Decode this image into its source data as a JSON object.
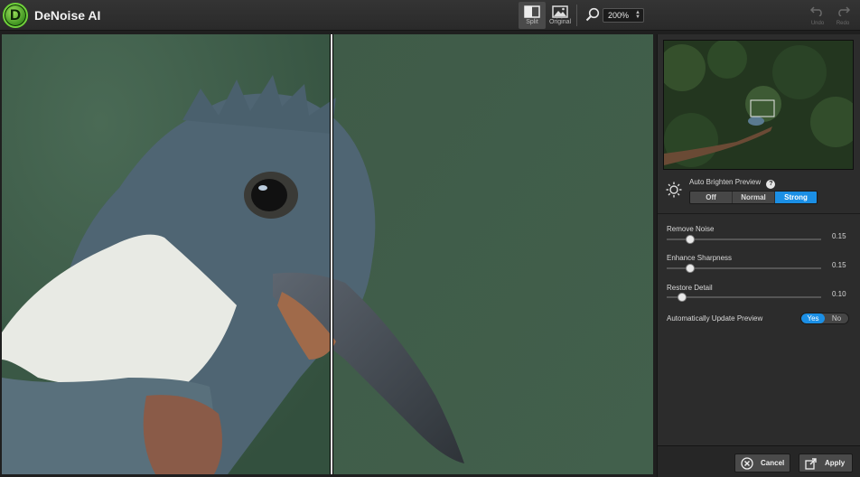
{
  "app": {
    "logo_letter": "D",
    "title": "DeNoise AI"
  },
  "toolbar": {
    "split_label": "Split",
    "original_label": "Original",
    "zoom_value": "200%",
    "undo_label": "Undo",
    "redo_label": "Redo"
  },
  "panel": {
    "auto_brighten": {
      "label": "Auto Brighten Preview",
      "help": "?",
      "options": [
        "Off",
        "Normal",
        "Strong"
      ],
      "selected": "Strong"
    },
    "sliders": [
      {
        "label": "Remove Noise",
        "value": "0.15",
        "fraction": 0.15
      },
      {
        "label": "Enhance Sharpness",
        "value": "0.15",
        "fraction": 0.15
      },
      {
        "label": "Restore Detail",
        "value": "0.10",
        "fraction": 0.1
      }
    ],
    "auto_update": {
      "label": "Automatically Update Preview",
      "yes": "Yes",
      "no": "No",
      "selected": "Yes"
    }
  },
  "footer": {
    "cancel_label": "Cancel",
    "apply_label": "Apply"
  },
  "colors": {
    "accent": "#1b8fe5",
    "logo_green": "#6fd13a",
    "background": "#2c2c2c"
  }
}
